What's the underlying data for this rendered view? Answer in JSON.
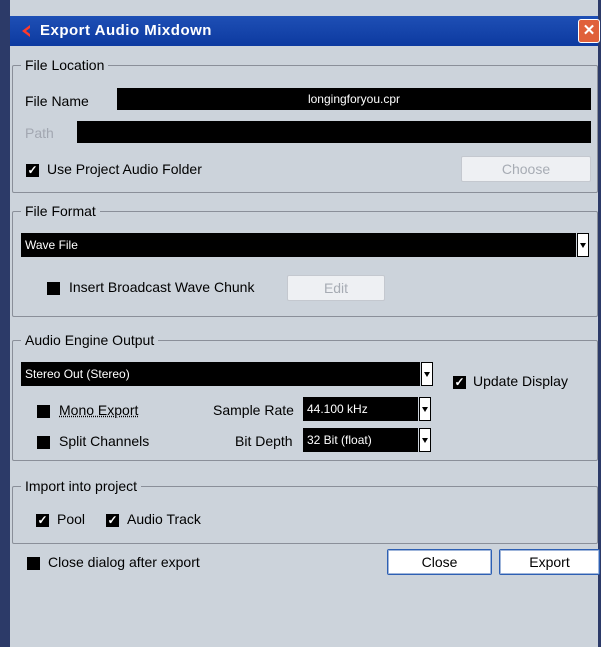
{
  "window": {
    "title": "Export Audio Mixdown",
    "close_glyph": "✕",
    "logo_icon": "cubase-logo-icon"
  },
  "file_location": {
    "legend": "File Location",
    "file_name_label": "File Name",
    "file_name_value": "longingforyou.cpr",
    "path_label": "Path",
    "path_value": "",
    "use_project_folder_label": "Use Project Audio Folder",
    "use_project_folder_checked": true,
    "choose_button": "Choose"
  },
  "file_format": {
    "legend": "File Format",
    "format_value": "Wave File",
    "broadcast_label": "Insert Broadcast Wave Chunk",
    "broadcast_checked": false,
    "edit_button": "Edit"
  },
  "audio_engine": {
    "legend": "Audio Engine Output",
    "output_value": "Stereo Out (Stereo)",
    "update_display_label": "Update Display",
    "update_display_checked": true,
    "mono_export_label": "Mono Export",
    "mono_export_checked": false,
    "split_channels_label": "Split Channels",
    "split_channels_checked": false,
    "sample_rate_label": "Sample Rate",
    "sample_rate_value": "44.100 kHz",
    "bit_depth_label": "Bit Depth",
    "bit_depth_value": "32 Bit (float)"
  },
  "import_project": {
    "legend": "Import into project",
    "pool_label": "Pool",
    "pool_checked": true,
    "audio_track_label": "Audio Track",
    "audio_track_checked": true
  },
  "footer": {
    "close_after_export_label": "Close dialog after export",
    "close_after_export_checked": false,
    "close_button": "Close",
    "export_button": "Export"
  },
  "check_glyph": "✓"
}
